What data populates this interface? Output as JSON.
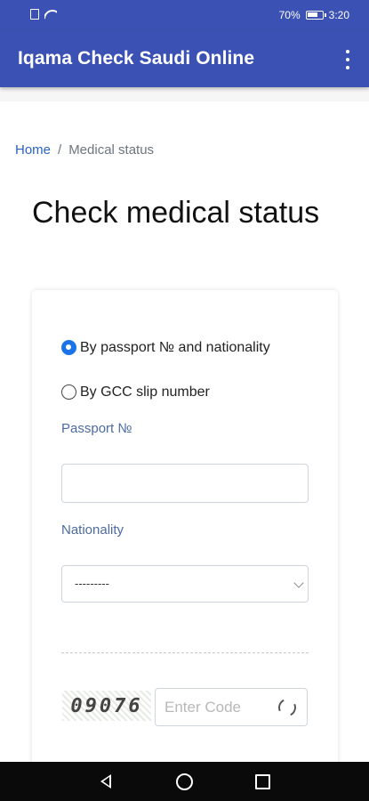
{
  "status_bar": {
    "battery_level": "70%",
    "time": "3:20",
    "icons": [
      "sim-icon",
      "wifi-icon",
      "battery-icon"
    ]
  },
  "app_bar": {
    "title": "Iqama Check Saudi Online",
    "menu_icon": "more-vert-icon"
  },
  "breadcrumb": {
    "home": "Home",
    "separator": "/",
    "current": "Medical status"
  },
  "page": {
    "title": "Check medical status"
  },
  "form": {
    "options": [
      {
        "label": "By passport № and nationality",
        "checked": true
      },
      {
        "label": "By GCC slip number",
        "checked": false
      }
    ],
    "passport_label": "Passport №",
    "passport_value": "",
    "nationality_label": "Nationality",
    "nationality_selected": "---------",
    "captcha_text": "09076",
    "captcha_placeholder": "Enter Code",
    "refresh_icon": "refresh-icon"
  },
  "nav_bar": {
    "icons": [
      "back-icon",
      "home-icon",
      "recents-icon"
    ]
  },
  "colors": {
    "primary": "#3b52b4",
    "link": "#2a62c4",
    "label": "#4c6ba3",
    "radio_checked": "#1a73e8"
  }
}
